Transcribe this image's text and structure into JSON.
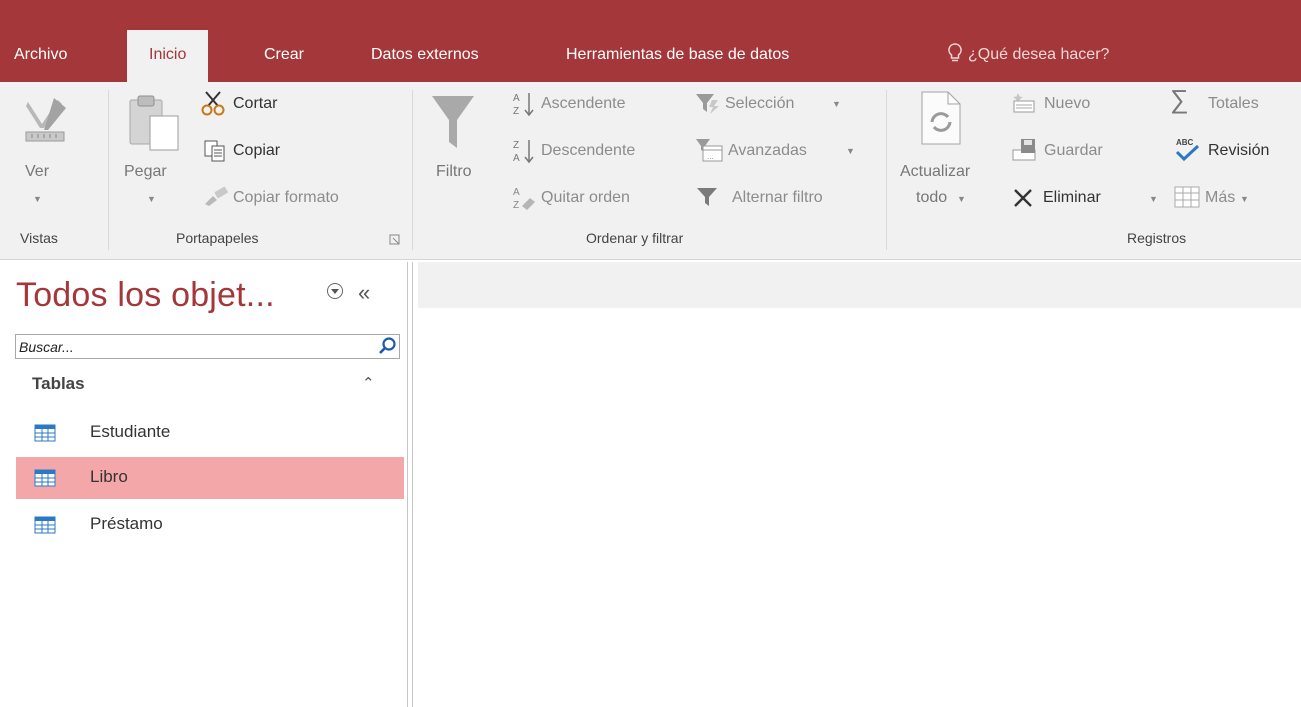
{
  "tabs": {
    "archivo": "Archivo",
    "inicio": "Inicio",
    "crear": "Crear",
    "datos_externos": "Datos externos",
    "herramientas": "Herramientas de base de datos",
    "tell_me": "¿Qué desea hacer?"
  },
  "ribbon": {
    "vistas": {
      "ver": "Ver",
      "group": "Vistas"
    },
    "portapapeles": {
      "pegar": "Pegar",
      "cortar": "Cortar",
      "copiar": "Copiar",
      "copiar_formato": "Copiar formato",
      "group": "Portapapeles"
    },
    "ordenar": {
      "filtro": "Filtro",
      "ascendente": "Ascendente",
      "descendente": "Descendente",
      "quitar_orden": "Quitar orden",
      "seleccion": "Selección",
      "avanzadas": "Avanzadas",
      "alternar": "Alternar filtro",
      "group": "Ordenar y filtrar"
    },
    "registros": {
      "actualizar": "Actualizar",
      "todo": "todo",
      "nuevo": "Nuevo",
      "guardar": "Guardar",
      "eliminar": "Eliminar",
      "totales": "Totales",
      "revision": "Revisión",
      "mas": "Más",
      "group": "Registros"
    }
  },
  "nav": {
    "title": "Todos los objet...",
    "search_placeholder": "Buscar...",
    "group": "Tablas",
    "items": [
      "Estudiante",
      "Libro",
      "Préstamo"
    ],
    "selected": "Libro"
  },
  "colors": {
    "accent": "#a4373a",
    "ribbon_bg": "#f1f1f1",
    "selection": "#f4a7a9"
  }
}
